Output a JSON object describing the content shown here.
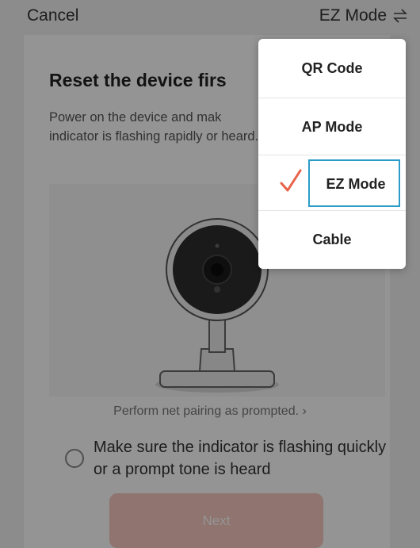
{
  "topbar": {
    "cancel_label": "Cancel",
    "mode_label": "EZ Mode",
    "mode_icon": "swap-icon"
  },
  "content": {
    "title": "Reset the device firs",
    "description": "Power on the device and mak indicator is flashing rapidly or heard.",
    "pairing_link": "Perform net pairing as prompted. ›",
    "checkbox_label": "Make sure the indicator is flashing quickly or a prompt tone is heard",
    "next_label": "Next"
  },
  "mode_menu": {
    "items": [
      {
        "label": "QR Code",
        "selected": false
      },
      {
        "label": "AP Mode",
        "selected": false
      },
      {
        "label": "EZ Mode",
        "selected": true
      },
      {
        "label": "Cable",
        "selected": false
      }
    ],
    "check_icon": "check-icon"
  },
  "colors": {
    "accent_check": "#e8624a",
    "selection_border": "#2a9cc8",
    "next_button_disabled": "#f6c9c0"
  }
}
